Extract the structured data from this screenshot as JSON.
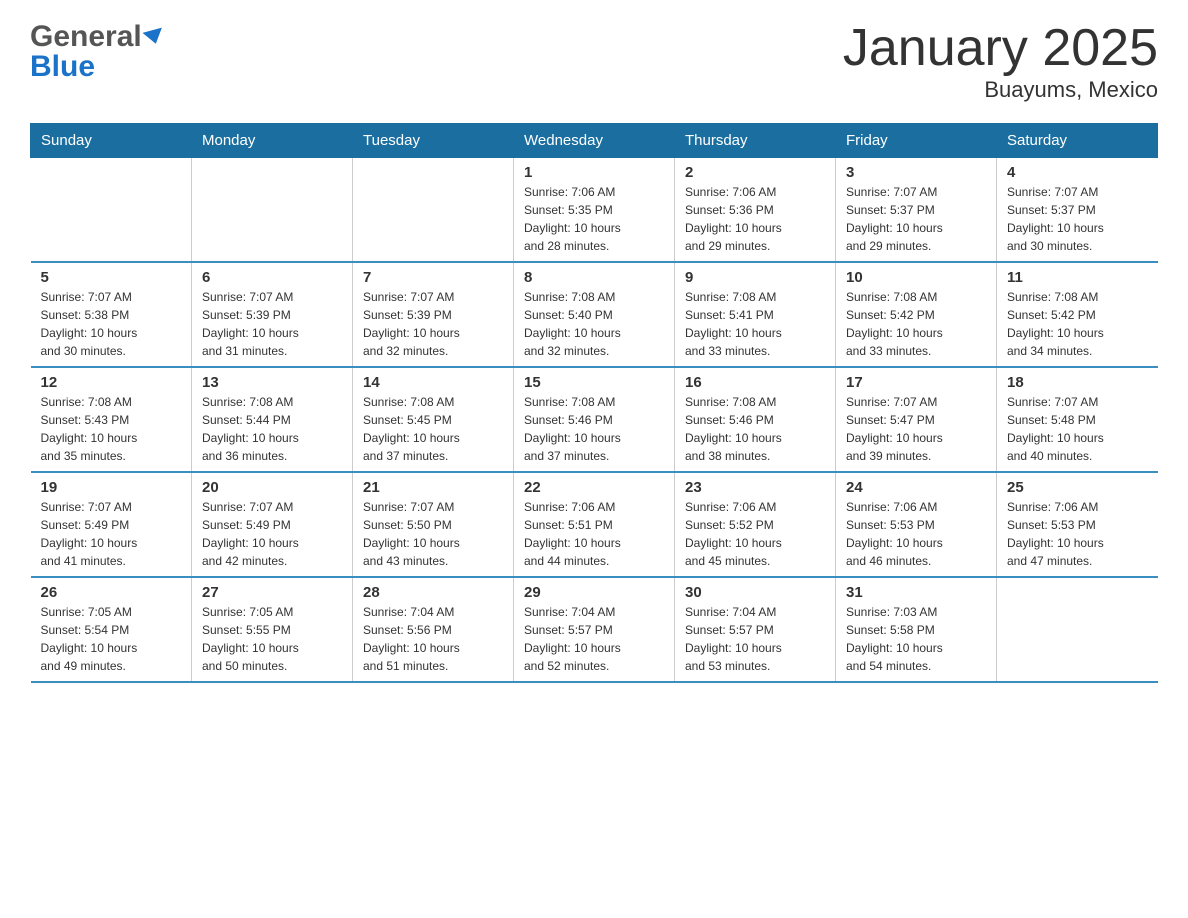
{
  "header": {
    "title": "January 2025",
    "location": "Buayums, Mexico",
    "logo_general": "General",
    "logo_blue": "Blue"
  },
  "days_of_week": [
    "Sunday",
    "Monday",
    "Tuesday",
    "Wednesday",
    "Thursday",
    "Friday",
    "Saturday"
  ],
  "weeks": [
    [
      {
        "day": "",
        "info": ""
      },
      {
        "day": "",
        "info": ""
      },
      {
        "day": "",
        "info": ""
      },
      {
        "day": "1",
        "info": "Sunrise: 7:06 AM\nSunset: 5:35 PM\nDaylight: 10 hours\nand 28 minutes."
      },
      {
        "day": "2",
        "info": "Sunrise: 7:06 AM\nSunset: 5:36 PM\nDaylight: 10 hours\nand 29 minutes."
      },
      {
        "day": "3",
        "info": "Sunrise: 7:07 AM\nSunset: 5:37 PM\nDaylight: 10 hours\nand 29 minutes."
      },
      {
        "day": "4",
        "info": "Sunrise: 7:07 AM\nSunset: 5:37 PM\nDaylight: 10 hours\nand 30 minutes."
      }
    ],
    [
      {
        "day": "5",
        "info": "Sunrise: 7:07 AM\nSunset: 5:38 PM\nDaylight: 10 hours\nand 30 minutes."
      },
      {
        "day": "6",
        "info": "Sunrise: 7:07 AM\nSunset: 5:39 PM\nDaylight: 10 hours\nand 31 minutes."
      },
      {
        "day": "7",
        "info": "Sunrise: 7:07 AM\nSunset: 5:39 PM\nDaylight: 10 hours\nand 32 minutes."
      },
      {
        "day": "8",
        "info": "Sunrise: 7:08 AM\nSunset: 5:40 PM\nDaylight: 10 hours\nand 32 minutes."
      },
      {
        "day": "9",
        "info": "Sunrise: 7:08 AM\nSunset: 5:41 PM\nDaylight: 10 hours\nand 33 minutes."
      },
      {
        "day": "10",
        "info": "Sunrise: 7:08 AM\nSunset: 5:42 PM\nDaylight: 10 hours\nand 33 minutes."
      },
      {
        "day": "11",
        "info": "Sunrise: 7:08 AM\nSunset: 5:42 PM\nDaylight: 10 hours\nand 34 minutes."
      }
    ],
    [
      {
        "day": "12",
        "info": "Sunrise: 7:08 AM\nSunset: 5:43 PM\nDaylight: 10 hours\nand 35 minutes."
      },
      {
        "day": "13",
        "info": "Sunrise: 7:08 AM\nSunset: 5:44 PM\nDaylight: 10 hours\nand 36 minutes."
      },
      {
        "day": "14",
        "info": "Sunrise: 7:08 AM\nSunset: 5:45 PM\nDaylight: 10 hours\nand 37 minutes."
      },
      {
        "day": "15",
        "info": "Sunrise: 7:08 AM\nSunset: 5:46 PM\nDaylight: 10 hours\nand 37 minutes."
      },
      {
        "day": "16",
        "info": "Sunrise: 7:08 AM\nSunset: 5:46 PM\nDaylight: 10 hours\nand 38 minutes."
      },
      {
        "day": "17",
        "info": "Sunrise: 7:07 AM\nSunset: 5:47 PM\nDaylight: 10 hours\nand 39 minutes."
      },
      {
        "day": "18",
        "info": "Sunrise: 7:07 AM\nSunset: 5:48 PM\nDaylight: 10 hours\nand 40 minutes."
      }
    ],
    [
      {
        "day": "19",
        "info": "Sunrise: 7:07 AM\nSunset: 5:49 PM\nDaylight: 10 hours\nand 41 minutes."
      },
      {
        "day": "20",
        "info": "Sunrise: 7:07 AM\nSunset: 5:49 PM\nDaylight: 10 hours\nand 42 minutes."
      },
      {
        "day": "21",
        "info": "Sunrise: 7:07 AM\nSunset: 5:50 PM\nDaylight: 10 hours\nand 43 minutes."
      },
      {
        "day": "22",
        "info": "Sunrise: 7:06 AM\nSunset: 5:51 PM\nDaylight: 10 hours\nand 44 minutes."
      },
      {
        "day": "23",
        "info": "Sunrise: 7:06 AM\nSunset: 5:52 PM\nDaylight: 10 hours\nand 45 minutes."
      },
      {
        "day": "24",
        "info": "Sunrise: 7:06 AM\nSunset: 5:53 PM\nDaylight: 10 hours\nand 46 minutes."
      },
      {
        "day": "25",
        "info": "Sunrise: 7:06 AM\nSunset: 5:53 PM\nDaylight: 10 hours\nand 47 minutes."
      }
    ],
    [
      {
        "day": "26",
        "info": "Sunrise: 7:05 AM\nSunset: 5:54 PM\nDaylight: 10 hours\nand 49 minutes."
      },
      {
        "day": "27",
        "info": "Sunrise: 7:05 AM\nSunset: 5:55 PM\nDaylight: 10 hours\nand 50 minutes."
      },
      {
        "day": "28",
        "info": "Sunrise: 7:04 AM\nSunset: 5:56 PM\nDaylight: 10 hours\nand 51 minutes."
      },
      {
        "day": "29",
        "info": "Sunrise: 7:04 AM\nSunset: 5:57 PM\nDaylight: 10 hours\nand 52 minutes."
      },
      {
        "day": "30",
        "info": "Sunrise: 7:04 AM\nSunset: 5:57 PM\nDaylight: 10 hours\nand 53 minutes."
      },
      {
        "day": "31",
        "info": "Sunrise: 7:03 AM\nSunset: 5:58 PM\nDaylight: 10 hours\nand 54 minutes."
      },
      {
        "day": "",
        "info": ""
      }
    ]
  ]
}
